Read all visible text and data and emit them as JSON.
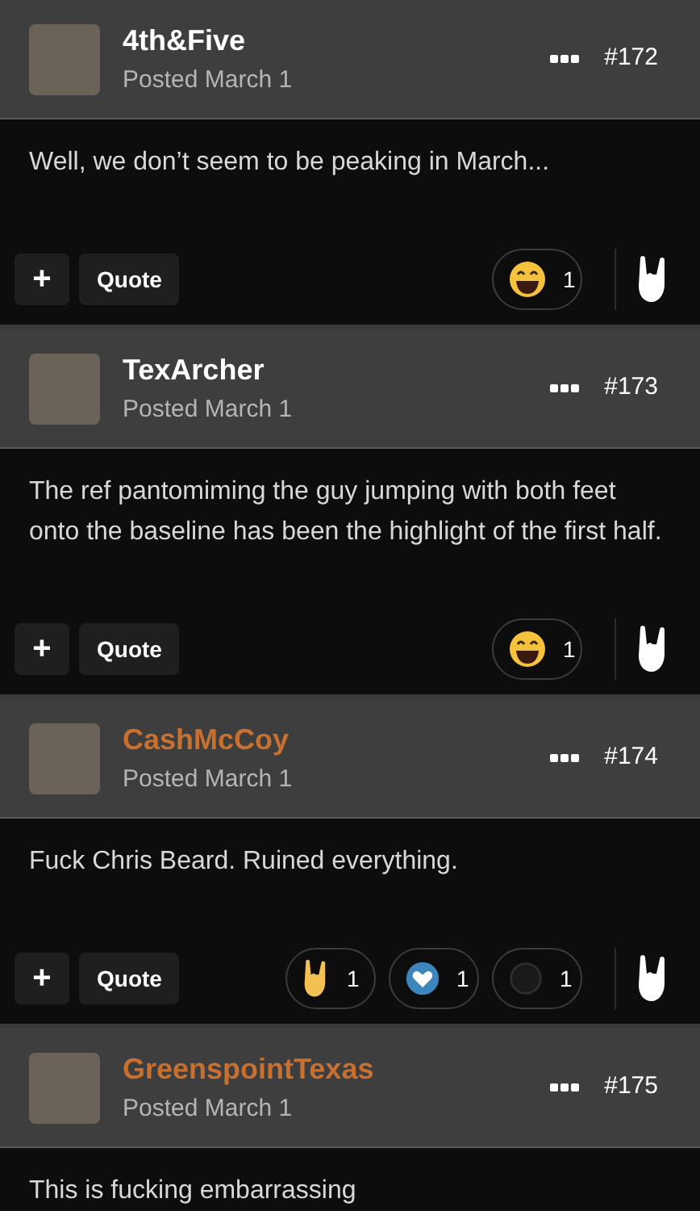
{
  "posts": [
    {
      "author": {
        "name": "4th&Five",
        "color": "#ffffff"
      },
      "posted": "Posted March 1",
      "number": "#172",
      "body": "Well, we don’t seem to be peaking in March...",
      "actions": [
        "+",
        "Quote"
      ],
      "reactions": [
        {
          "kind": "laugh",
          "count": "1"
        }
      ]
    },
    {
      "author": {
        "name": "TexArcher",
        "color": "#ffffff"
      },
      "posted": "Posted March 1",
      "number": "#173",
      "body": "The ref pantomiming the guy jumping with both feet onto the baseline has been the highlight of the first half.",
      "actions": [
        "+",
        "Quote"
      ],
      "reactions": [
        {
          "kind": "laugh",
          "count": "1"
        }
      ]
    },
    {
      "author": {
        "name": "CashMcCoy",
        "color": "#c8702f"
      },
      "posted": "Posted March 1",
      "number": "#174",
      "body": "Fuck Chris Beard. Ruined everything.",
      "actions": [
        "+",
        "Quote"
      ],
      "reactions": [
        {
          "kind": "rock",
          "count": "1"
        },
        {
          "kind": "heart",
          "count": "1"
        },
        {
          "kind": "faded",
          "count": "1"
        }
      ]
    },
    {
      "author": {
        "name": "GreenspointTexas",
        "color": "#c8702f"
      },
      "posted": "Posted March 1",
      "number": "#175",
      "body": "This is fucking embarrassing"
    }
  ]
}
